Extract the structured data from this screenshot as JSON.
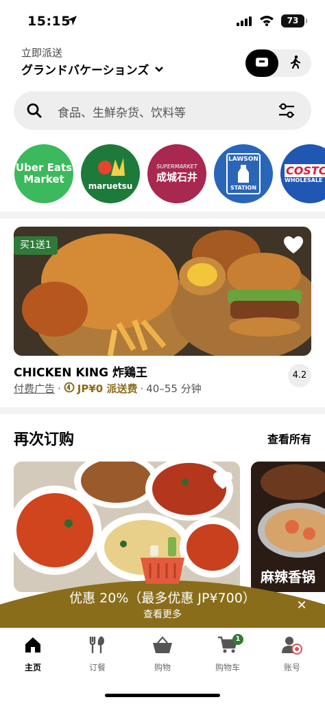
{
  "status": {
    "time": "15:15",
    "battery": "73"
  },
  "header": {
    "deliver_label": "立即派送",
    "address": "グランドバケーションズ"
  },
  "search": {
    "placeholder": "食品、生鮮杂货、饮料等"
  },
  "stores": [
    {
      "name": "Uber Eats Market",
      "line1": "Uber Eats",
      "line2": "Market",
      "color": "#3cb95c"
    },
    {
      "name": "maruetsu",
      "color": "#1e7a3a"
    },
    {
      "name": "成城石井",
      "top": "SUPERMARKET",
      "color": "#a8284f"
    },
    {
      "name": "Lawson Station",
      "line1": "LAWSON",
      "line2": "STATION",
      "color": "#2a66b8"
    },
    {
      "name": "Costco",
      "line1": "COSTCO",
      "line2": "WHOLESALE",
      "color": "#1f57b3"
    }
  ],
  "featured": {
    "badge": "买1送1",
    "name": "CHICKEN KING 炸鶏王",
    "ad_label": "付费广告",
    "fee": "JP¥0 派送费",
    "time": "40–55 分钟",
    "rating": "4.2"
  },
  "reorder": {
    "title": "再次订购",
    "see_all": "查看所有",
    "card2_text": "麻辣香锅"
  },
  "offer": {
    "text": "优惠 20%（最多优惠 JP¥700）",
    "sub": "查看更多",
    "bg_color": "#8a6d1b"
  },
  "tabs": [
    {
      "label": "主页",
      "icon": "home-icon",
      "active": true
    },
    {
      "label": "订餐",
      "icon": "utensils-icon"
    },
    {
      "label": "购物",
      "icon": "basket-icon"
    },
    {
      "label": "购物车",
      "icon": "cart-icon",
      "badge": "1"
    },
    {
      "label": "账号",
      "icon": "account-icon"
    }
  ]
}
